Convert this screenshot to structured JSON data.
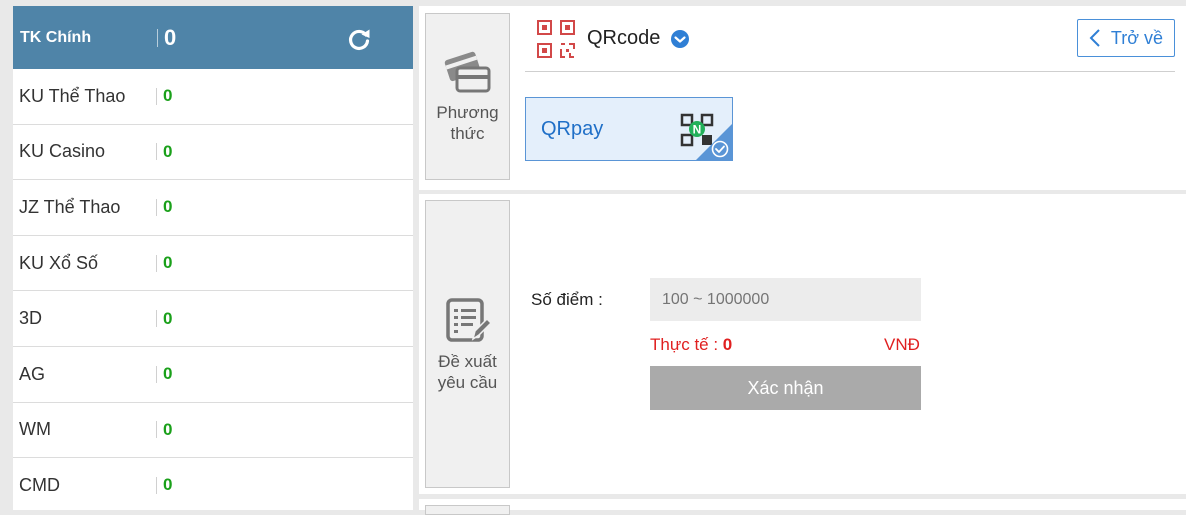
{
  "wallet": {
    "main": {
      "label": "TK Chính",
      "balance": "0"
    },
    "rows": [
      {
        "label": "KU Thể Thao",
        "balance": "0"
      },
      {
        "label": "KU Casino",
        "balance": "0"
      },
      {
        "label": "JZ Thể Thao",
        "balance": "0"
      },
      {
        "label": "KU Xổ Số",
        "balance": "0"
      },
      {
        "label": "3D",
        "balance": "0"
      },
      {
        "label": "AG",
        "balance": "0"
      },
      {
        "label": "WM",
        "balance": "0"
      },
      {
        "label": "CMD",
        "balance": "0"
      }
    ],
    "refresh_icon": "refresh-icon"
  },
  "method": {
    "tab_label_1": "Phương",
    "tab_label_2": "thức",
    "title": "QRcode",
    "back_label": "Trở về",
    "option_label": "QRpay",
    "option_badge": "N"
  },
  "request": {
    "tab_label_1": "Đề xuất",
    "tab_label_2": "yêu cầu",
    "points_label": "Số điểm :",
    "points_placeholder": "100 ~ 1000000",
    "actual_label": "Thực tế : ",
    "actual_value": "0",
    "currency": "VNĐ",
    "confirm_label": "Xác nhận"
  },
  "colors": {
    "header_bg": "#4f84a8",
    "accent": "#2f7fd5",
    "balance_green": "#1aa01a",
    "warning_red": "#e02020",
    "disabled_button": "#aaaaaa"
  }
}
